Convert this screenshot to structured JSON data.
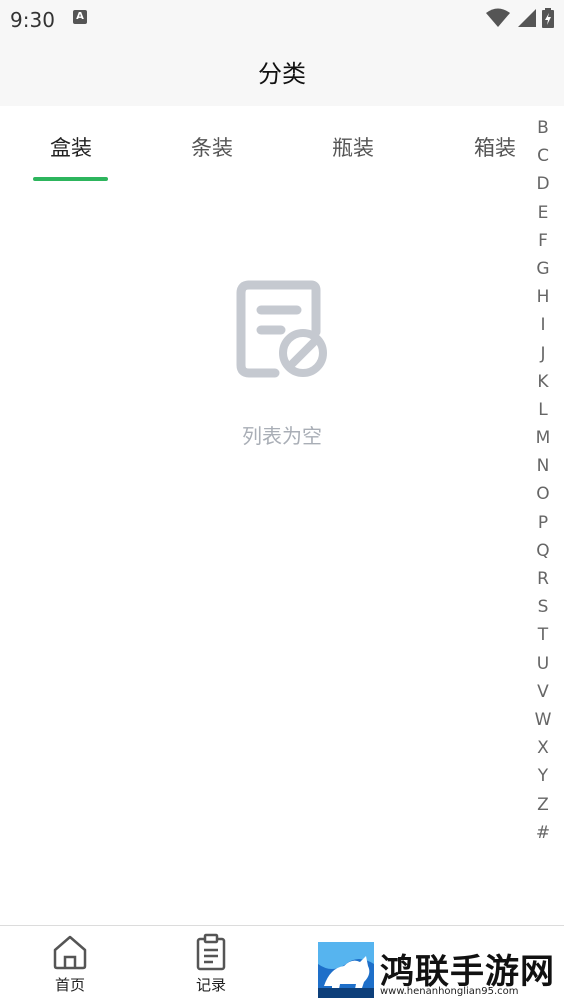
{
  "status_bar": {
    "time": "9:30",
    "notification_glyph": "A"
  },
  "header": {
    "title": "分类"
  },
  "tabs": [
    {
      "label": "盒装",
      "active": true
    },
    {
      "label": "条装",
      "active": false
    },
    {
      "label": "瓶装",
      "active": false
    },
    {
      "label": "箱装",
      "active": false
    }
  ],
  "empty_state": {
    "icon": "empty-list-icon",
    "text": "列表为空"
  },
  "alphabet_index": [
    "B",
    "C",
    "D",
    "E",
    "F",
    "G",
    "H",
    "I",
    "J",
    "K",
    "L",
    "M",
    "N",
    "O",
    "P",
    "Q",
    "R",
    "S",
    "T",
    "U",
    "V",
    "W",
    "X",
    "Y",
    "Z",
    "#"
  ],
  "bottom_nav": [
    {
      "label": "首页",
      "icon": "home-icon"
    },
    {
      "label": "记录",
      "icon": "clipboard-icon"
    }
  ],
  "watermark": {
    "name": "鸿联手游网",
    "url": "www.henanhonglian95.com"
  },
  "colors": {
    "accent": "#2db55d",
    "empty_gray": "#c5c9d0",
    "header_bg": "#f7f7f7"
  }
}
